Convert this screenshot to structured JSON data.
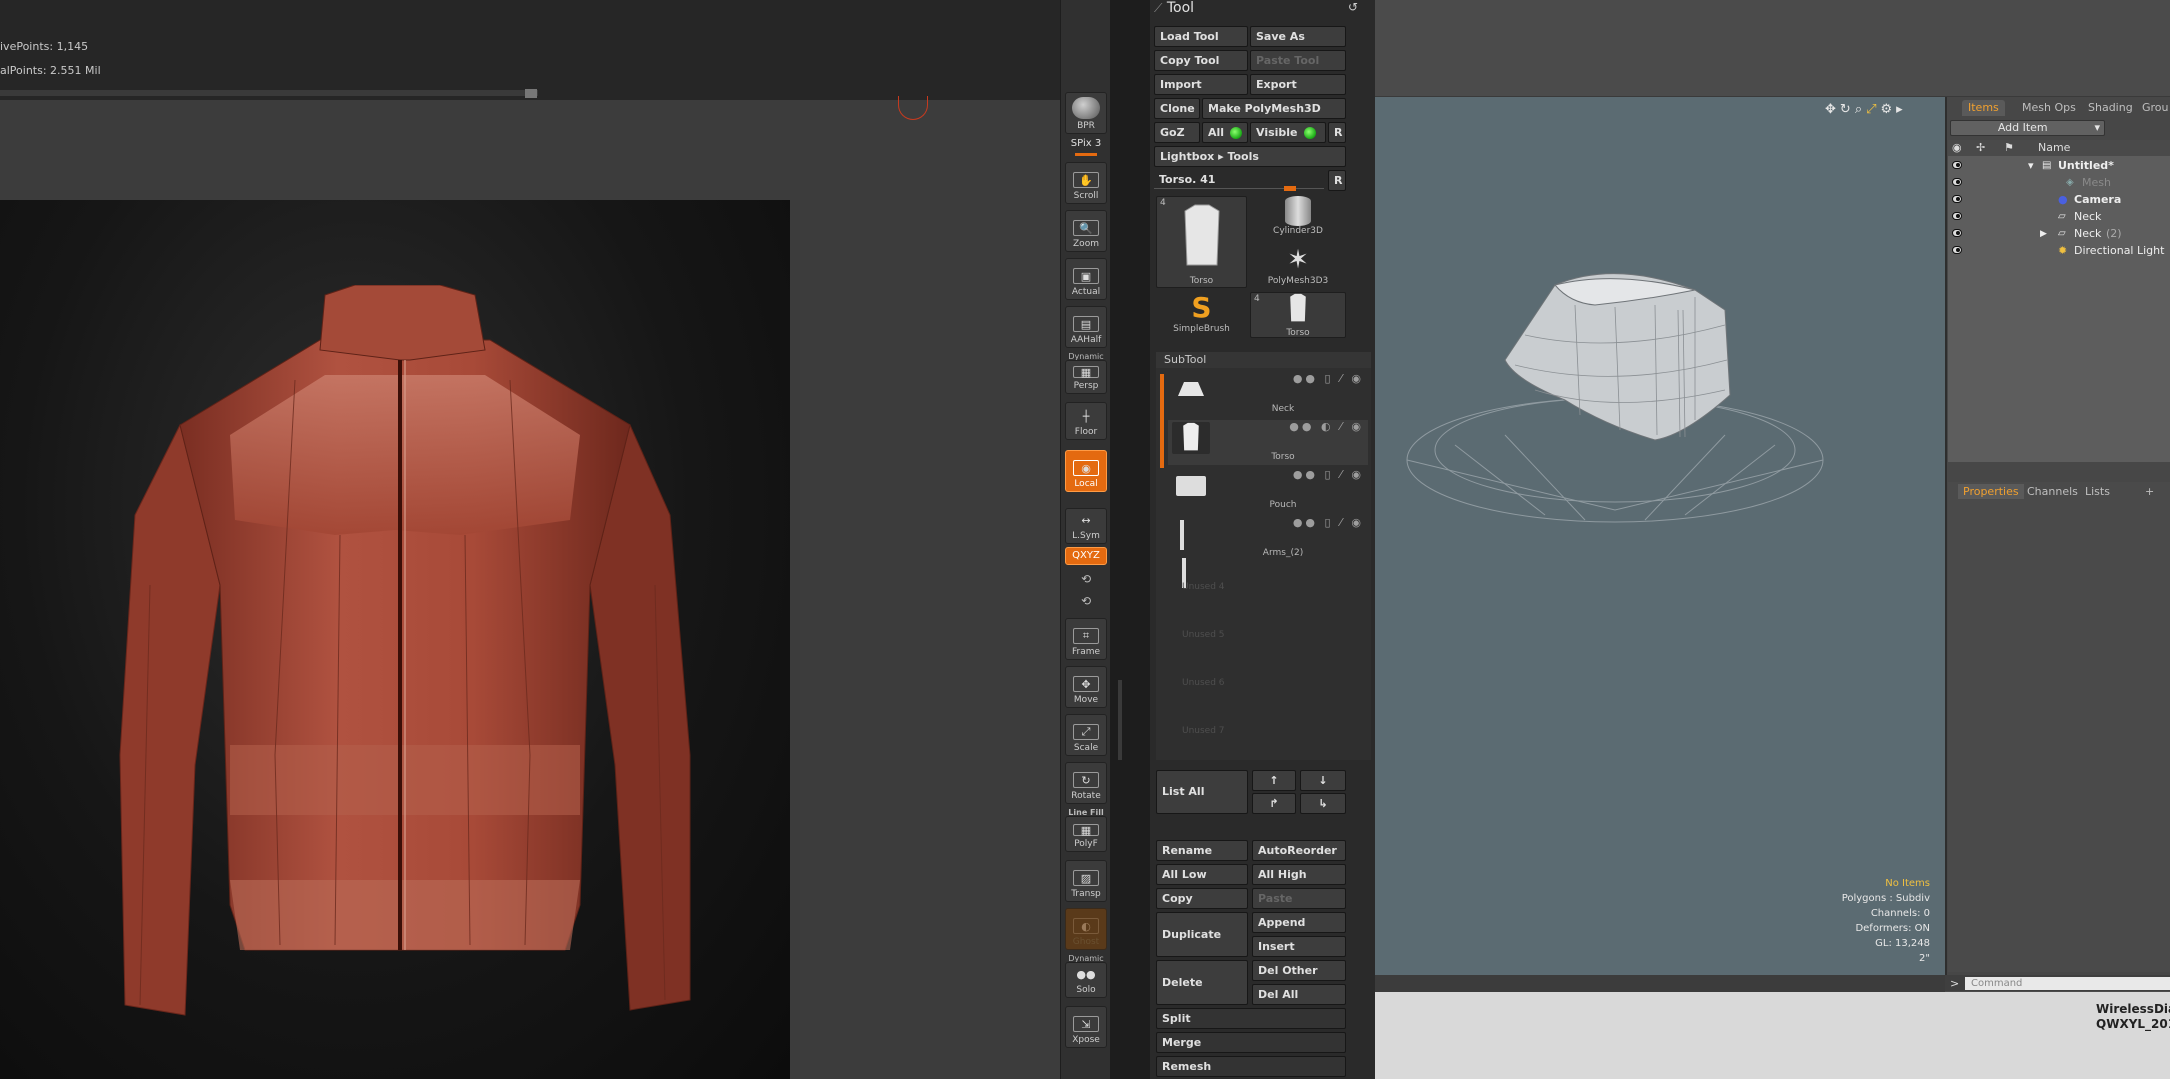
{
  "zbrush": {
    "active_points": "ivePoints: 1,145",
    "total_points": "alPoints: 2.551  Mil"
  },
  "shelf": {
    "bpr": "BPR",
    "spix": "SPix 3",
    "scroll": "Scroll",
    "zoom": "Zoom",
    "actual": "Actual",
    "aahalf": "AAHalf",
    "dynamic": "Dynamic",
    "persp": "Persp",
    "floor": "Floor",
    "local": "Local",
    "lsym": "L.Sym",
    "xyz": "QXYZ",
    "frame": "Frame",
    "move": "Move",
    "scale": "Scale",
    "rotate": "Rotate",
    "line_fill": "Line Fill",
    "polyf": "PolyF",
    "transp": "Transp",
    "ghost": "Ghost",
    "dynamic2": "Dynamic",
    "solo": "Solo",
    "xpose": "Xpose"
  },
  "tool": {
    "title": "Tool",
    "load_tool": "Load Tool",
    "save_as": "Save As",
    "copy_tool": "Copy Tool",
    "paste_tool": "Paste Tool",
    "import": "Import",
    "export": "Export",
    "clone": "Clone",
    "make_polymesh": "Make PolyMesh3D",
    "goz": "GoZ",
    "all": "All",
    "visible": "Visible",
    "r": "R",
    "lightbox": "Lightbox ▸ Tools",
    "current_tool": "Torso. 41",
    "r2": "R",
    "thumbs": {
      "torso_count": "4",
      "torso": "Torso",
      "cylinder": "Cylinder3D",
      "polymesh": "PolyMesh3D3",
      "simplebrush": "SimpleBrush",
      "torso2_count": "4",
      "torso2": "Torso"
    }
  },
  "subtool": {
    "header": "SubTool",
    "items": [
      "Neck",
      "Torso",
      "Pouch",
      "Arms_(2)"
    ],
    "unused": [
      "Unused 4",
      "Unused 5",
      "Unused 6",
      "Unused 7"
    ],
    "list_all": "List All",
    "rename": "Rename",
    "autoreorder": "AutoReorder",
    "all_low": "All Low",
    "all_high": "All High",
    "copy": "Copy",
    "paste": "Paste",
    "duplicate": "Duplicate",
    "append": "Append",
    "insert": "Insert",
    "delete": "Delete",
    "del_other": "Del Other",
    "del_all": "Del All",
    "split": "Split",
    "merge": "Merge",
    "remesh": "Remesh"
  },
  "modo": {
    "tabs": [
      "Items",
      "Mesh Ops",
      "Shading",
      "Grou"
    ],
    "add_item": "Add Item",
    "name_col": "Name",
    "tree": [
      {
        "label": "Untitled*",
        "bold": true
      },
      {
        "label": "Mesh",
        "dim": true
      },
      {
        "label": "Camera",
        "bold": true
      },
      {
        "label": "Neck"
      },
      {
        "label": "Neck",
        "suffix": "(2)"
      },
      {
        "label": "Directional Light"
      }
    ],
    "prop_tabs": [
      "Properties",
      "Channels",
      "Lists",
      "+"
    ],
    "info": {
      "no_items": "No Items",
      "polygons": "Polygons : Subdiv",
      "channels": "Channels: 0",
      "deformers": "Deformers: ON",
      "gl": "GL: 13,248",
      "unit": "2\""
    },
    "command_prompt": ">",
    "command_placeholder": "Command",
    "status_line1": "WirelessDiad",
    "status_line2": "QWXYL_201"
  },
  "colors": {
    "accent_orange": "#e46a10",
    "jacket": "#a84a38",
    "modo_viewport": "#5b6b72",
    "led_green": "#1fae1a"
  }
}
